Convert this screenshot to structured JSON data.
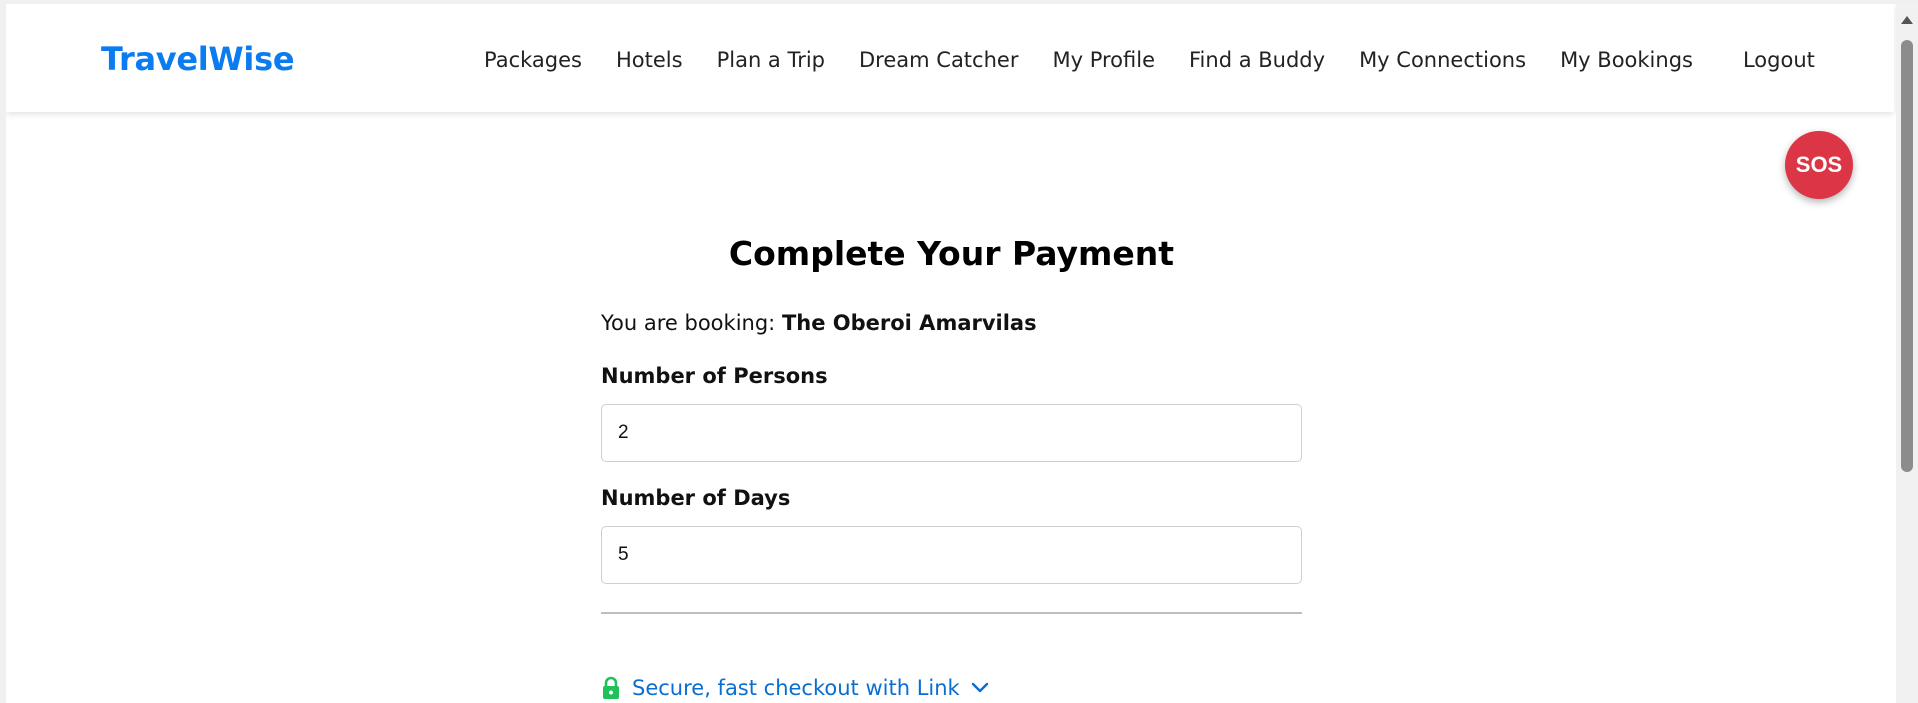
{
  "brand": "TravelWise",
  "nav": {
    "items": [
      "Packages",
      "Hotels",
      "Plan a Trip",
      "Dream Catcher",
      "My Profile",
      "Find a Buddy",
      "My Connections",
      "My Bookings"
    ],
    "logout": "Logout"
  },
  "sos_label": "SOS",
  "payment": {
    "title": "Complete Your Payment",
    "booking_prefix": "You are booking:",
    "booking_name": "The Oberoi Amarvilas",
    "persons_label": "Number of Persons",
    "persons_value": "2",
    "days_label": "Number of Days",
    "days_value": "5",
    "link_text": "Secure, fast checkout with Link"
  },
  "colors": {
    "brand": "#0a7cf0",
    "sos": "#dc3545",
    "link": "#0a6ed1",
    "lock": "#1fc15b"
  },
  "icons": [
    "lock-icon",
    "chevron-down-icon"
  ]
}
